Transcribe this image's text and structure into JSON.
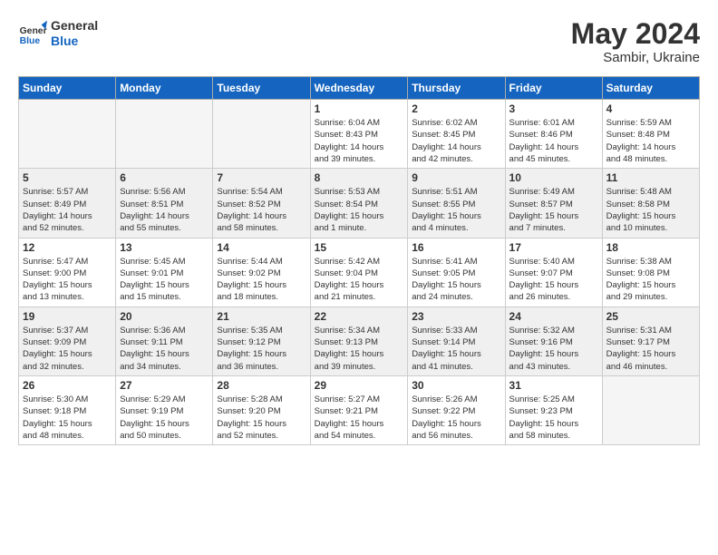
{
  "header": {
    "logo_line1": "General",
    "logo_line2": "Blue",
    "month_year": "May 2024",
    "location": "Sambir, Ukraine"
  },
  "weekdays": [
    "Sunday",
    "Monday",
    "Tuesday",
    "Wednesday",
    "Thursday",
    "Friday",
    "Saturday"
  ],
  "weeks": [
    [
      {
        "day": "",
        "info": ""
      },
      {
        "day": "",
        "info": ""
      },
      {
        "day": "",
        "info": ""
      },
      {
        "day": "1",
        "info": "Sunrise: 6:04 AM\nSunset: 8:43 PM\nDaylight: 14 hours\nand 39 minutes."
      },
      {
        "day": "2",
        "info": "Sunrise: 6:02 AM\nSunset: 8:45 PM\nDaylight: 14 hours\nand 42 minutes."
      },
      {
        "day": "3",
        "info": "Sunrise: 6:01 AM\nSunset: 8:46 PM\nDaylight: 14 hours\nand 45 minutes."
      },
      {
        "day": "4",
        "info": "Sunrise: 5:59 AM\nSunset: 8:48 PM\nDaylight: 14 hours\nand 48 minutes."
      }
    ],
    [
      {
        "day": "5",
        "info": "Sunrise: 5:57 AM\nSunset: 8:49 PM\nDaylight: 14 hours\nand 52 minutes."
      },
      {
        "day": "6",
        "info": "Sunrise: 5:56 AM\nSunset: 8:51 PM\nDaylight: 14 hours\nand 55 minutes."
      },
      {
        "day": "7",
        "info": "Sunrise: 5:54 AM\nSunset: 8:52 PM\nDaylight: 14 hours\nand 58 minutes."
      },
      {
        "day": "8",
        "info": "Sunrise: 5:53 AM\nSunset: 8:54 PM\nDaylight: 15 hours\nand 1 minute."
      },
      {
        "day": "9",
        "info": "Sunrise: 5:51 AM\nSunset: 8:55 PM\nDaylight: 15 hours\nand 4 minutes."
      },
      {
        "day": "10",
        "info": "Sunrise: 5:49 AM\nSunset: 8:57 PM\nDaylight: 15 hours\nand 7 minutes."
      },
      {
        "day": "11",
        "info": "Sunrise: 5:48 AM\nSunset: 8:58 PM\nDaylight: 15 hours\nand 10 minutes."
      }
    ],
    [
      {
        "day": "12",
        "info": "Sunrise: 5:47 AM\nSunset: 9:00 PM\nDaylight: 15 hours\nand 13 minutes."
      },
      {
        "day": "13",
        "info": "Sunrise: 5:45 AM\nSunset: 9:01 PM\nDaylight: 15 hours\nand 15 minutes."
      },
      {
        "day": "14",
        "info": "Sunrise: 5:44 AM\nSunset: 9:02 PM\nDaylight: 15 hours\nand 18 minutes."
      },
      {
        "day": "15",
        "info": "Sunrise: 5:42 AM\nSunset: 9:04 PM\nDaylight: 15 hours\nand 21 minutes."
      },
      {
        "day": "16",
        "info": "Sunrise: 5:41 AM\nSunset: 9:05 PM\nDaylight: 15 hours\nand 24 minutes."
      },
      {
        "day": "17",
        "info": "Sunrise: 5:40 AM\nSunset: 9:07 PM\nDaylight: 15 hours\nand 26 minutes."
      },
      {
        "day": "18",
        "info": "Sunrise: 5:38 AM\nSunset: 9:08 PM\nDaylight: 15 hours\nand 29 minutes."
      }
    ],
    [
      {
        "day": "19",
        "info": "Sunrise: 5:37 AM\nSunset: 9:09 PM\nDaylight: 15 hours\nand 32 minutes."
      },
      {
        "day": "20",
        "info": "Sunrise: 5:36 AM\nSunset: 9:11 PM\nDaylight: 15 hours\nand 34 minutes."
      },
      {
        "day": "21",
        "info": "Sunrise: 5:35 AM\nSunset: 9:12 PM\nDaylight: 15 hours\nand 36 minutes."
      },
      {
        "day": "22",
        "info": "Sunrise: 5:34 AM\nSunset: 9:13 PM\nDaylight: 15 hours\nand 39 minutes."
      },
      {
        "day": "23",
        "info": "Sunrise: 5:33 AM\nSunset: 9:14 PM\nDaylight: 15 hours\nand 41 minutes."
      },
      {
        "day": "24",
        "info": "Sunrise: 5:32 AM\nSunset: 9:16 PM\nDaylight: 15 hours\nand 43 minutes."
      },
      {
        "day": "25",
        "info": "Sunrise: 5:31 AM\nSunset: 9:17 PM\nDaylight: 15 hours\nand 46 minutes."
      }
    ],
    [
      {
        "day": "26",
        "info": "Sunrise: 5:30 AM\nSunset: 9:18 PM\nDaylight: 15 hours\nand 48 minutes."
      },
      {
        "day": "27",
        "info": "Sunrise: 5:29 AM\nSunset: 9:19 PM\nDaylight: 15 hours\nand 50 minutes."
      },
      {
        "day": "28",
        "info": "Sunrise: 5:28 AM\nSunset: 9:20 PM\nDaylight: 15 hours\nand 52 minutes."
      },
      {
        "day": "29",
        "info": "Sunrise: 5:27 AM\nSunset: 9:21 PM\nDaylight: 15 hours\nand 54 minutes."
      },
      {
        "day": "30",
        "info": "Sunrise: 5:26 AM\nSunset: 9:22 PM\nDaylight: 15 hours\nand 56 minutes."
      },
      {
        "day": "31",
        "info": "Sunrise: 5:25 AM\nSunset: 9:23 PM\nDaylight: 15 hours\nand 58 minutes."
      },
      {
        "day": "",
        "info": ""
      }
    ]
  ]
}
